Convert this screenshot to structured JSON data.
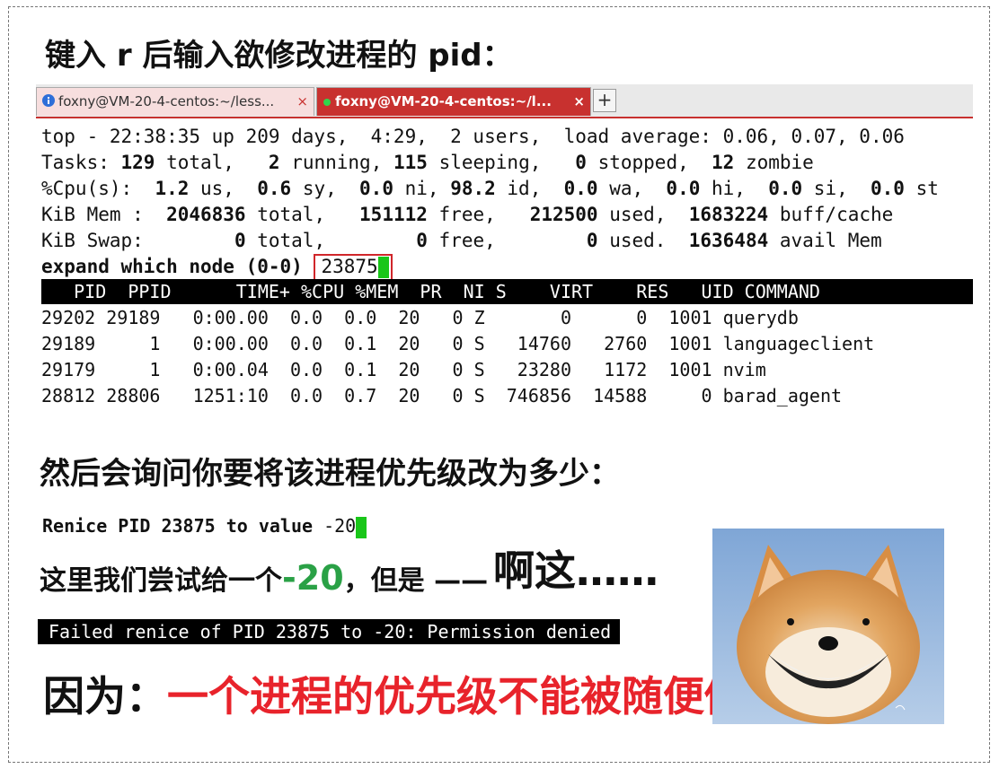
{
  "heading_top": "键入 r 后输入欲修改进程的 pid：",
  "tabs": [
    {
      "label": "foxny@VM-20-4-centos:~/less...",
      "close": "×"
    },
    {
      "label": "foxny@VM-20-4-centos:~/l...",
      "close": "×"
    }
  ],
  "new_tab": "+",
  "top_lines": {
    "l1": "top - 22:38:35 up 209 days,  4:29,  2 users,  load average: 0.06, 0.07, 0.06",
    "tasks_label": "Tasks: ",
    "tasks_total": "129",
    "tasks_total_label": " total,   ",
    "tasks_running": "2",
    "tasks_running_label": " running, ",
    "tasks_sleeping": "115",
    "tasks_sleeping_label": " sleeping,   ",
    "tasks_stopped": "0",
    "tasks_stopped_label": " stopped,  ",
    "tasks_zombie": "12",
    "tasks_zombie_label": " zombie",
    "cpu_label": "%Cpu(s):  ",
    "cpu_us": "1.2",
    "cpu_us_label": " us,  ",
    "cpu_sy": "0.6",
    "cpu_sy_label": " sy,  ",
    "cpu_ni": "0.0",
    "cpu_ni_label": " ni, ",
    "cpu_id": "98.2",
    "cpu_id_label": " id,  ",
    "cpu_wa": "0.0",
    "cpu_wa_label": " wa,  ",
    "cpu_hi": "0.0",
    "cpu_hi_label": " hi,  ",
    "cpu_si": "0.0",
    "cpu_si_label": " si,  ",
    "cpu_st": "0.0",
    "cpu_st_label": " st",
    "mem_label": "KiB Mem :  ",
    "mem_total": "2046836",
    "mem_total_label": " total,   ",
    "mem_free": "151112",
    "mem_free_label": " free,   ",
    "mem_used": "212500",
    "mem_used_label": " used,  ",
    "mem_buff": "1683224",
    "mem_buff_label": " buff/cache",
    "swap_label": "KiB Swap:        ",
    "swap_total": "0",
    "swap_total_label": " total,        ",
    "swap_free": "0",
    "swap_free_label": " free,        ",
    "swap_used": "0",
    "swap_used_label": " used.  ",
    "swap_avail": "1636484",
    "swap_avail_label": " avail Mem",
    "prompt": "expand which node (0-0) ",
    "pid_value": "23875"
  },
  "process_header": "   PID  PPID      TIME+ %CPU %MEM  PR  NI S    VIRT    RES   UID COMMAND",
  "processes": [
    "29202 29189   0:00.00  0.0  0.0  20   0 Z       0      0  1001 querydb",
    "29189     1   0:00.00  0.0  0.1  20   0 S   14760   2760  1001 languageclient",
    "29179     1   0:00.04  0.0  0.1  20   0 S   23280   1172  1001 nvim",
    "28812 28806   1251:10  0.0  0.7  20   0 S  746856  14588     0 barad_agent"
  ],
  "heading_mid": "然后会询问你要将该进程优先级改为多少：",
  "renice_prompt": "Renice PID 23875 to value ",
  "renice_value": "-20",
  "try_text": "这里我们尝试给一个",
  "try_value": "-20",
  "try_text2": "，但是 ——",
  "aa_text": "啊这……",
  "failed_msg": "Failed renice of PID 23875 to -20: Permission denied",
  "because_label": "因为：",
  "because_text": "一个进程的优先级不能被随便修改",
  "colors": {
    "accent_red": "#c8312f",
    "green": "#2aa146",
    "cursor": "#19c619",
    "red_text": "#e8232b"
  },
  "icons": {
    "tab1": "info-icon",
    "tab2": "green-dot-icon"
  }
}
